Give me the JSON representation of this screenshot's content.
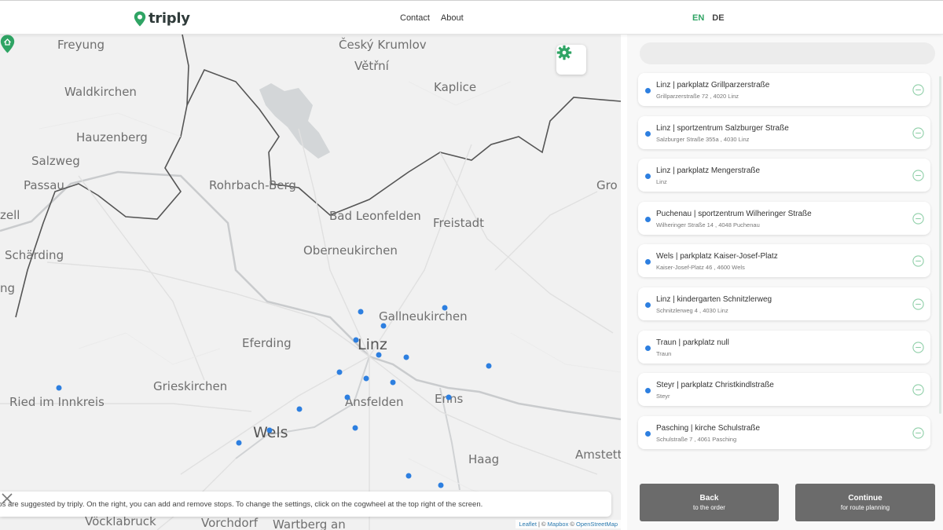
{
  "header": {
    "logo_text": "triply",
    "nav": [
      "Contact",
      "About"
    ],
    "languages": {
      "active": "EN",
      "inactive": "DE"
    }
  },
  "colors": {
    "brand_green": "#2fa464",
    "stop_blue": "#2d7fe0",
    "button_grey": "#6b6b6b"
  },
  "map": {
    "places": [
      {
        "name": "Freyung",
        "size": "small"
      },
      {
        "name": "Český Krumlov",
        "size": "small"
      },
      {
        "name": "Větřní",
        "size": "small"
      },
      {
        "name": "Waldkirchen",
        "size": "small"
      },
      {
        "name": "Kaplice",
        "size": "small"
      },
      {
        "name": "Hauzenberg",
        "size": "small"
      },
      {
        "name": "Salzweg",
        "size": "small"
      },
      {
        "name": "Passau",
        "size": "small"
      },
      {
        "name": "Rohrbach-Berg",
        "size": "small"
      },
      {
        "name": "Gro",
        "size": "small"
      },
      {
        "name": "zell",
        "size": "small"
      },
      {
        "name": "Bad Leonfelden",
        "size": "small"
      },
      {
        "name": "Freistadt",
        "size": "small"
      },
      {
        "name": "Schärding",
        "size": "small"
      },
      {
        "name": "Oberneukirchen",
        "size": "small"
      },
      {
        "name": "ng",
        "size": "small"
      },
      {
        "name": "Gallneukirchen",
        "size": "small"
      },
      {
        "name": "Eferding",
        "size": "small"
      },
      {
        "name": "Linz",
        "size": "big"
      },
      {
        "name": "Grieskirchen",
        "size": "small"
      },
      {
        "name": "Ried im Innkreis",
        "size": "small"
      },
      {
        "name": "Ansfelden",
        "size": "small"
      },
      {
        "name": "Enns",
        "size": "small"
      },
      {
        "name": "Wels",
        "size": "big"
      },
      {
        "name": "Haag",
        "size": "small"
      },
      {
        "name": "Amstett",
        "size": "small"
      },
      {
        "name": "Vöcklabruck",
        "size": "small"
      },
      {
        "name": "Vorchdorf",
        "size": "small"
      },
      {
        "name": "Wartberg an",
        "size": "small"
      }
    ],
    "info_text": "ops are suggested by triply. On the right, you can add and remove stops. To change the settings, click on the cogwheel at the top right of the screen.",
    "attribution": {
      "leaflet": "Leaflet",
      "sep1": " | © ",
      "mapbox": "Mapbox",
      "sep2": " © ",
      "osm": "OpenStreetMap"
    }
  },
  "panel": {
    "search_placeholder": "",
    "stops": [
      {
        "title": "Linz | parkplatz Grillparzerstraße",
        "address": "Grillparzerstraße 72 , 4020 Linz"
      },
      {
        "title": "Linz | sportzentrum Salzburger Straße",
        "address": "Salzburger Straße 355a , 4030 Linz"
      },
      {
        "title": "Linz | parkplatz Mengerstraße",
        "address": "Linz"
      },
      {
        "title": "Puchenau | sportzentrum Wilheringer Straße",
        "address": "Wilheringer Straße 14 , 4048 Puchenau"
      },
      {
        "title": "Wels | parkplatz Kaiser-Josef-Platz",
        "address": "Kaiser-Josef-Platz 46 , 4600 Wels"
      },
      {
        "title": "Linz | kindergarten Schnitzlerweg",
        "address": "Schnitzlerweg 4 , 4030 Linz"
      },
      {
        "title": "Traun | parkplatz null",
        "address": "Traun"
      },
      {
        "title": "Steyr | parkplatz Christkindlstraße",
        "address": "Steyr"
      },
      {
        "title": "Pasching | kirche Schulstraße",
        "address": "Schulstraße 7 , 4061 Pasching"
      }
    ],
    "back": {
      "label": "Back",
      "sub": "to the order"
    },
    "continue": {
      "label": "Continue",
      "sub": "for route planning"
    }
  }
}
